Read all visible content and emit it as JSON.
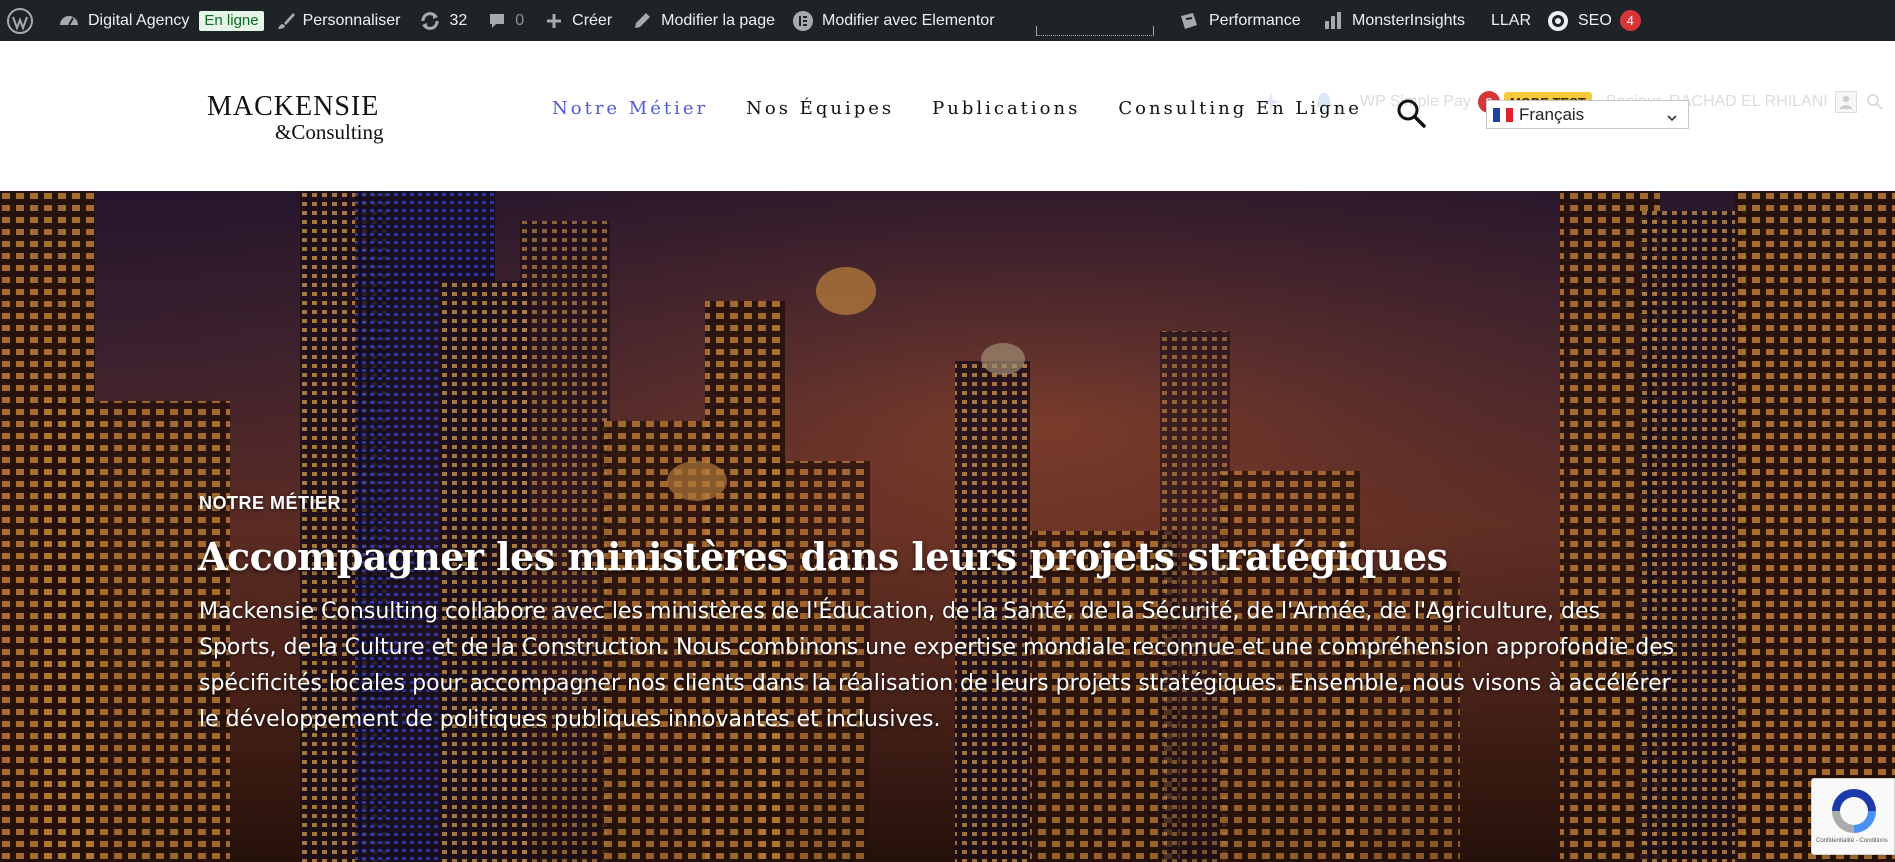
{
  "admin_bar": {
    "site_name": "Digital Agency",
    "status_badge": "En ligne",
    "customize": "Personnaliser",
    "updates_count": "32",
    "comments_count": "0",
    "create": "Créer",
    "edit_page": "Modifier la page",
    "edit_elementor": "Modifier avec Elementor",
    "performance": "Performance",
    "monsterinsights": "MonsterInsights",
    "llar": "LLAR",
    "seo": "SEO",
    "seo_count": "4"
  },
  "top_right": {
    "wp_simple_pay": "WP Simple Pay",
    "wp_simple_pay_count": "2",
    "mode_test": "MODE TEST",
    "greeting": "Bonjour, RACHAD EL RHILANI"
  },
  "header": {
    "logo_line1": "MACKENSIE",
    "logo_line2": "&Consulting",
    "nav": [
      {
        "label": "Notre Métier",
        "active": true
      },
      {
        "label": "Nos Équipes",
        "active": false
      },
      {
        "label": "Publications",
        "active": false
      },
      {
        "label": "Consulting En Ligne",
        "active": false
      }
    ],
    "language": "Français"
  },
  "hero": {
    "eyebrow": "NOTRE MÉTIER",
    "title": "Accompagner les ministères dans leurs projets stratégiques",
    "text": "Mackensie Consulting collabore avec les ministères de l'Éducation, de la Santé, de la Sécurité, de l'Armée, de l'Agriculture, des Sports, de la Culture et de la Construction. Nous combinons une expertise mondiale reconnue et une compréhension approfondie des spécificités locales pour accompagner nos clients dans la réalisation de leurs projets stratégiques. Ensemble, nous visons à accélérer le développement de politiques publiques innovantes et inclusives."
  },
  "recaptcha": {
    "legal": "Confidentialité - Conditions"
  },
  "colors": {
    "admin_bg": "#1d2327",
    "nav_active": "#4f5bd5",
    "badge_red": "#d63638",
    "mode_test": "#f5c93a"
  }
}
